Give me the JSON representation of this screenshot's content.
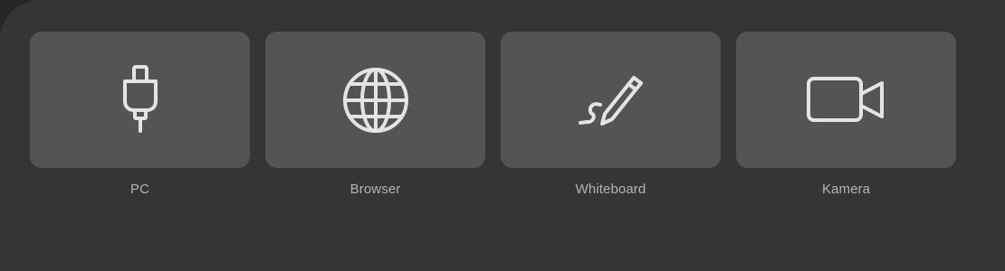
{
  "sources": [
    {
      "id": "pc",
      "label": "PC",
      "icon": "usb-plug-icon"
    },
    {
      "id": "browser",
      "label": "Browser",
      "icon": "globe-icon"
    },
    {
      "id": "whiteboard",
      "label": "Whiteboard",
      "icon": "pen-icon"
    },
    {
      "id": "camera",
      "label": "Kamera",
      "icon": "video-camera-icon"
    }
  ],
  "colors": {
    "background": "#262626",
    "panel": "#353535",
    "tile": "#545456",
    "icon_stroke": "#e4e4e6",
    "label": "#b4b4b6"
  }
}
